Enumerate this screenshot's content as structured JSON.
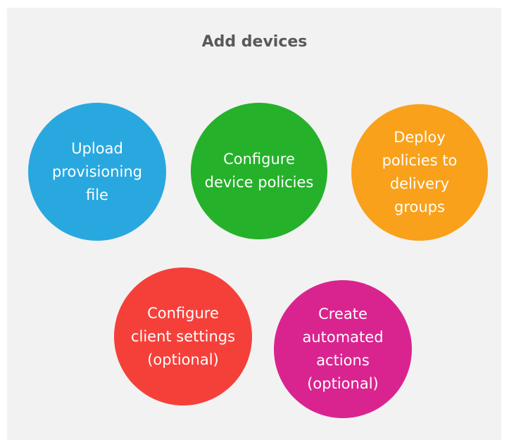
{
  "title": "Add devices",
  "steps": [
    {
      "label": "Upload\nprovisioning\nfile",
      "color": "#29a8e0"
    },
    {
      "label": "Configure\ndevice policies",
      "color": "#25b12a"
    },
    {
      "label": "Deploy\npolicies  to\ndelivery\ngroups",
      "color": "#f9a11b"
    },
    {
      "label": "Configure\nclient settings\n(optional)",
      "color": "#f5403a"
    },
    {
      "label": "Create\nautomated\nactions\n(optional)",
      "color": "#d9248f"
    }
  ]
}
